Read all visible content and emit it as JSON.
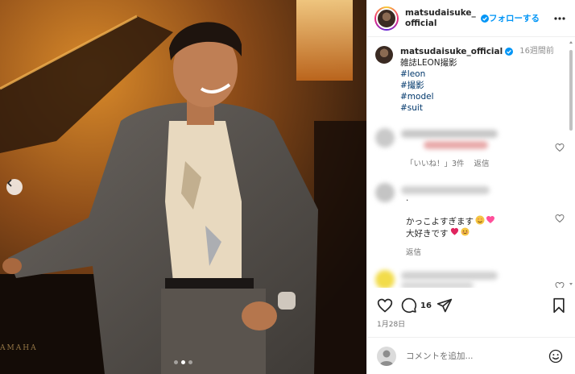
{
  "post": {
    "image": {
      "brand_print": "AMAHA",
      "carousel_dots": 3,
      "active_dot": 1
    },
    "header": {
      "username": "matsudaisuke_official",
      "follow_label": "フォローする"
    },
    "caption": {
      "username": "matsudaisuke_official",
      "time": "16週間前",
      "text": "雑誌LEON撮影",
      "hashtags": [
        "#leon",
        "#撮影",
        "#model",
        "#suit"
      ]
    },
    "comments": [
      {
        "likes_label": "「いいね！」3件",
        "reply_label": "返信"
      },
      {
        "dot": ".",
        "line1": "かっこよすぎます",
        "line2": "大好きです",
        "reply_label": "返信"
      }
    ],
    "actions": {
      "comment_count": "16"
    },
    "date": "1月28日",
    "add_comment": {
      "placeholder": "コメントを追加..."
    }
  },
  "colors": {
    "link_blue": "#0095f6",
    "hashtag": "#00376b",
    "secondary": "#737373",
    "border": "#efefef"
  }
}
